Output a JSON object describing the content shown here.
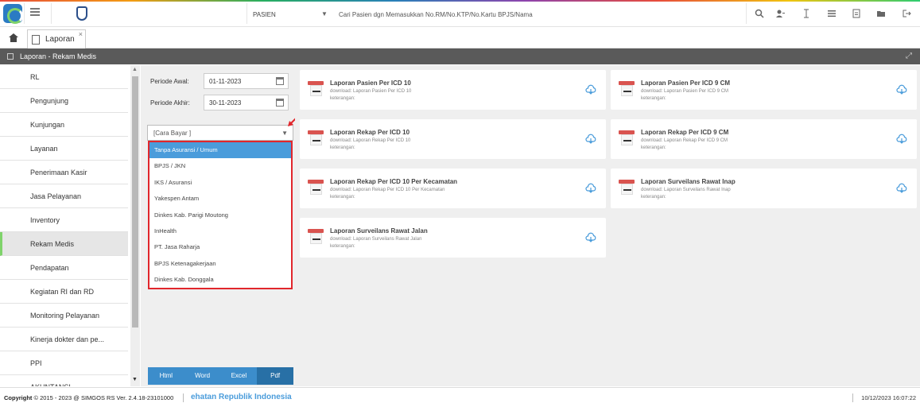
{
  "header": {
    "patient_type": "PASIEN",
    "search_placeholder": "Cari Pasien dgn Memasukkan No.RM/No.KTP/No.Kartu BPJS/Nama"
  },
  "tabs": [
    {
      "label": "Laporan",
      "close": "×"
    }
  ],
  "title_bar": {
    "title": "Laporan - Rekam Medis"
  },
  "sidebar": {
    "items": [
      {
        "label": "RL"
      },
      {
        "label": "Pengunjung"
      },
      {
        "label": "Kunjungan"
      },
      {
        "label": "Layanan"
      },
      {
        "label": "Penerimaan Kasir"
      },
      {
        "label": "Jasa Pelayanan"
      },
      {
        "label": "Inventory"
      },
      {
        "label": "Rekam Medis"
      },
      {
        "label": "Pendapatan"
      },
      {
        "label": "Kegiatan RI dan RD"
      },
      {
        "label": "Monitoring Pelayanan"
      },
      {
        "label": "Kinerja dokter dan pe..."
      },
      {
        "label": "PPI"
      },
      {
        "label": "AKUNTANSI"
      }
    ],
    "active_index": 7
  },
  "filter": {
    "start_label": "Periode Awal:",
    "start_value": "01-11-2023",
    "end_label": "Periode Akhir:",
    "end_value": "30-11-2023",
    "payment_select": "[Cara Bayar ]",
    "payment_options": [
      "Tanpa Asuransi / Umum",
      "BPJS / JKN",
      "IKS / Asuransi",
      "Yakespen Antam",
      "Dinkes Kab. Parigi Moutong",
      "InHealth",
      "PT. Jasa Raharja",
      "BPJS Ketenagakerjaan",
      "Dinkes Kab. Donggala"
    ],
    "selected_option_index": 0,
    "export_buttons": [
      "Html",
      "Word",
      "Excel",
      "Pdf"
    ]
  },
  "reports": [
    {
      "title": "Laporan Pasien Per ICD 10",
      "download": "download: Laporan Pasien Per ICD 10",
      "note": "keterangan:"
    },
    {
      "title": "Laporan Pasien Per ICD 9 CM",
      "download": "download: Laporan Pasien Per ICD 9 CM",
      "note": "keterangan:"
    },
    {
      "title": "Laporan Rekap Per ICD 10",
      "download": "download: Laporan Rekap Per ICD 10",
      "note": "keterangan:"
    },
    {
      "title": "Laporan Rekap Per ICD 9 CM",
      "download": "download: Laporan Rekap Per ICD 9 CM",
      "note": "keterangan:"
    },
    {
      "title": "Laporan Rekap Per ICD 10 Per Kecamatan",
      "download": "download: Laporan Rekap Per ICD 10 Per Kecamatan",
      "note": "keterangan:"
    },
    {
      "title": "Laporan Surveilans Rawat Inap",
      "download": "download: Laporan Surveilans Rawat Inap",
      "note": "keterangan:"
    },
    {
      "title": "Laporan Surveilans Rawat Jalan",
      "download": "download: Laporan Surveilans Rawat Jalan",
      "note": "keterangan:"
    }
  ],
  "footer": {
    "copyright_prefix": "Copyright",
    "copyright_text": "2015 - 2023 @ SIMGOS RS Ver. 2.4.18-23101000",
    "ministry": "ehatan Republik Indonesia",
    "datetime": "10/12/2023 16:07:22"
  },
  "colors": {
    "title_bar": "#5a5a5a",
    "selected_option": "#4a9cdb",
    "highlight_border": "#e1262c",
    "export_button": "#3c8dcb",
    "active_marker": "#7fd36b",
    "pdf_icon": "#d9534f"
  },
  "icons": [
    "app-logo-icon",
    "hamburger-menu-icon",
    "brand-logo-icon",
    "search-icon",
    "user-icon",
    "text-cursor-icon",
    "list-icon",
    "document-icon",
    "folder-icon",
    "logout-icon",
    "home-icon",
    "doc-icon",
    "calendar-icon",
    "pdf-file-icon",
    "cloud-download-icon",
    "expand-icon",
    "red-arrow-pointer"
  ]
}
